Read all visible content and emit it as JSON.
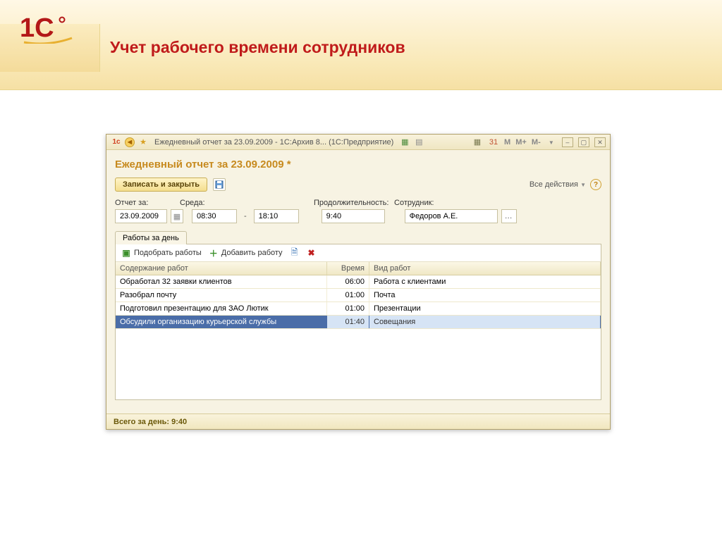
{
  "slide": {
    "title": "Учет рабочего времени сотрудников"
  },
  "titlebar": {
    "text": "Ежедневный отчет за 23.09.2009 - 1С:Архив 8...   (1С:Предприятие)",
    "m": "M",
    "mplus": "M+",
    "mminus": "M-"
  },
  "doc_title": "Ежедневный отчет за 23.09.2009 *",
  "cmdbar": {
    "save_close": "Записать и закрыть",
    "all_actions": "Все действия"
  },
  "labels": {
    "otchet_za": "Отчет за:",
    "sreda": "Среда:",
    "prod": "Продолжительность:",
    "sotr": "Сотрудник:"
  },
  "fields": {
    "date": "23.09.2009",
    "time_from": "08:30",
    "time_to": "18:10",
    "duration": "9:40",
    "employee": "Федоров А.Е."
  },
  "tab_label": "Работы за день",
  "work_toolbar": {
    "pick": "Подобрать работы",
    "add": "Добавить работу"
  },
  "grid": {
    "headers": {
      "content": "Содержание работ",
      "time": "Время",
      "type": "Вид работ"
    },
    "rows": [
      {
        "content": "Обработал 32 заявки клиентов",
        "time": "06:00",
        "type": "Работа с клиентами"
      },
      {
        "content": "Разобрал почту",
        "time": "01:00",
        "type": "Почта"
      },
      {
        "content": "Подготовил презентацию для ЗАО Лютик",
        "time": "01:00",
        "type": "Презентации"
      },
      {
        "content": "Обсудили организацию курьерской службы",
        "time": "01:40",
        "type": "Совещания"
      }
    ],
    "selected_index": 3
  },
  "status": "Всего за день: 9:40"
}
